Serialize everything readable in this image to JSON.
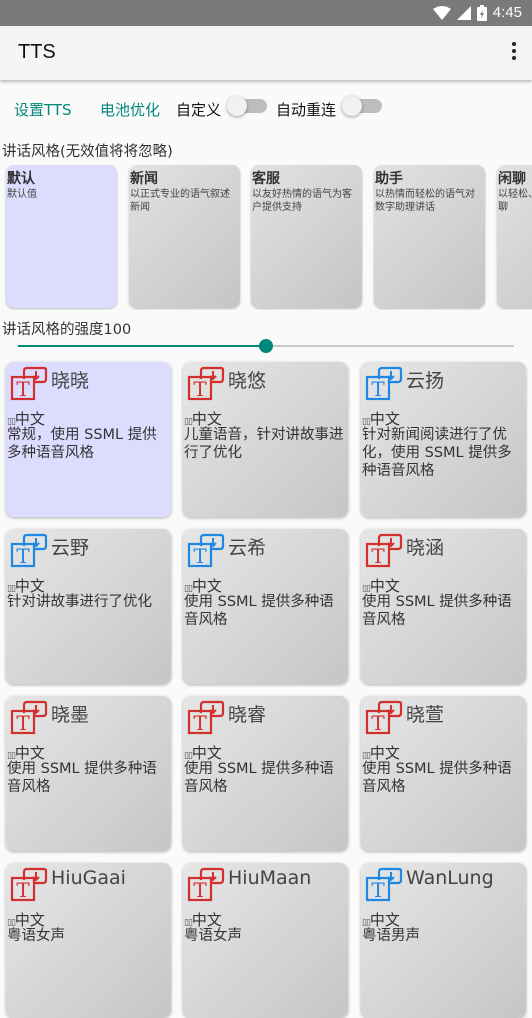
{
  "status_bar": {
    "time": "4:45",
    "icons": [
      "wifi-icon",
      "cell-signal-icon",
      "battery-icon"
    ]
  },
  "app_bar": {
    "title": "TTS",
    "menu_icon": "more-vert-icon"
  },
  "toolbar": {
    "set_tts": "设置TTS",
    "battery_opt": "电池优化",
    "custom_label": "自定义",
    "custom_on": false,
    "auto_reconnect_label": "自动重连",
    "auto_reconnect_on": false
  },
  "styles_section": {
    "label": "讲话风格(无效值将将忽略)",
    "items": [
      {
        "name": "默认",
        "desc": "默认值",
        "selected": true
      },
      {
        "name": "新闻",
        "desc": "以正式专业的语气叙述新闻",
        "selected": false
      },
      {
        "name": "客服",
        "desc": "以友好热情的语气为客户提供支持",
        "selected": false
      },
      {
        "name": "助手",
        "desc": "以热情而轻松的语气对数字助理讲话",
        "selected": false
      },
      {
        "name": "闲聊",
        "desc": "以轻松、随意的语气闲聊",
        "selected": false
      }
    ]
  },
  "intensity": {
    "label": "讲话风格的强度100",
    "fraction": 0.5
  },
  "voices": [
    {
      "name": "晓晓",
      "lang": "中文",
      "desc": "常规，使用 SSML 提供多种语音风格",
      "icon": "red",
      "selected": true
    },
    {
      "name": "晓悠",
      "lang": "中文",
      "desc": "儿童语音，针对讲故事进行了优化",
      "icon": "red",
      "selected": false
    },
    {
      "name": "云扬",
      "lang": "中文",
      "desc": "针对新闻阅读进行了优化，使用 SSML 提供多种语音风格",
      "icon": "blue",
      "selected": false
    },
    {
      "name": "云野",
      "lang": "中文",
      "desc": "针对讲故事进行了优化",
      "icon": "blue",
      "selected": false
    },
    {
      "name": "云希",
      "lang": "中文",
      "desc": "使用 SSML 提供多种语音风格",
      "icon": "blue",
      "selected": false
    },
    {
      "name": "晓涵",
      "lang": "中文",
      "desc": "使用 SSML 提供多种语音风格",
      "icon": "red",
      "selected": false
    },
    {
      "name": "晓墨",
      "lang": "中文",
      "desc": "使用 SSML 提供多种语音风格",
      "icon": "red",
      "selected": false
    },
    {
      "name": "晓睿",
      "lang": "中文",
      "desc": "使用 SSML 提供多种语音风格",
      "icon": "red",
      "selected": false
    },
    {
      "name": "晓萱",
      "lang": "中文",
      "desc": "使用 SSML 提供多种语音风格",
      "icon": "red",
      "selected": false
    },
    {
      "name": "HiuGaai",
      "lang": "中文",
      "desc": "粤语女声",
      "icon": "red",
      "selected": false
    },
    {
      "name": "HiuMaan",
      "lang": "中文",
      "desc": "粤语女声",
      "icon": "red",
      "selected": false
    },
    {
      "name": "WanLung",
      "lang": "中文",
      "desc": "粤语男声",
      "icon": "blue",
      "selected": false
    }
  ],
  "colors": {
    "accent": "#00897b",
    "selected_card": "#dcdcff",
    "icon_red": "#d32f2f",
    "icon_blue": "#1e88e5"
  }
}
